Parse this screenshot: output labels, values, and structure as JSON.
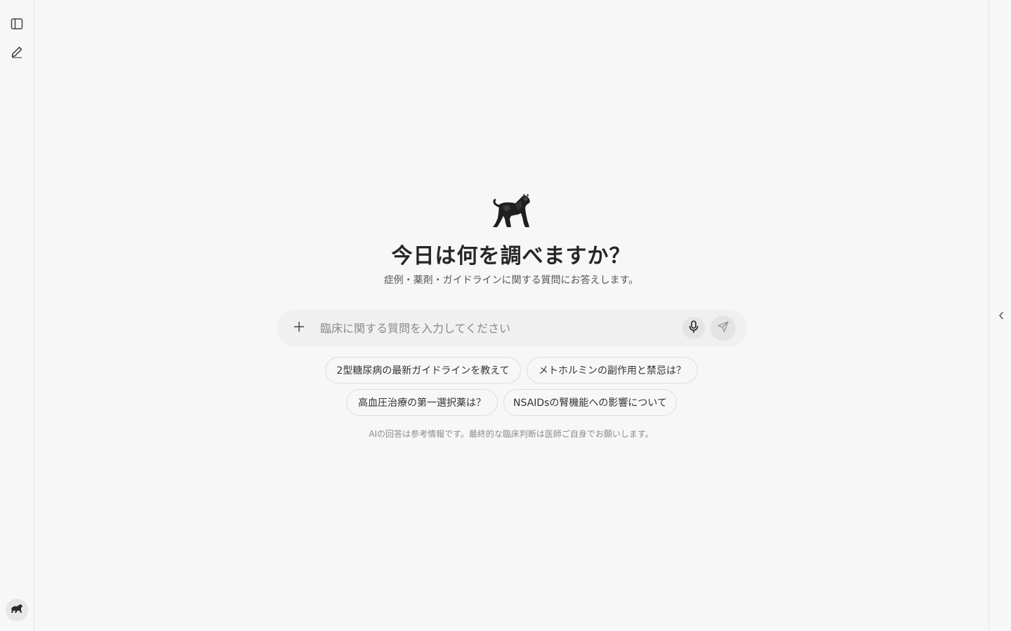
{
  "sidebar": {
    "toggle_icon": "sidebar-panel-icon",
    "new_chat_icon": "pencil-icon",
    "avatar_icon": "panther-avatar-icon"
  },
  "hero": {
    "logo_icon": "panther-logo-icon",
    "title": "今日は何を調べますか？",
    "subtitle": "症例・薬剤・ガイドラインに関する質問にお答えします。"
  },
  "composer": {
    "placeholder": "臨床に関する質問を入力してください",
    "value": "",
    "attach_icon": "plus-icon",
    "mic_icon": "microphone-icon",
    "send_icon": "send-icon"
  },
  "suggestions": [
    {
      "label": "2型糖尿病の最新ガイドラインを教えて"
    },
    {
      "label": "メトホルミンの副作用と禁忌は？"
    },
    {
      "label": "高血圧治療の第一選択薬は？"
    },
    {
      "label": "NSAIDsの腎機能への影響について"
    }
  ],
  "disclaimer": "AIの回答は参考情報です。最終的な臨床判断は医師ご自身でお願いします。",
  "right_panel": {
    "toggle_icon": "chevron-left-icon"
  },
  "colors": {
    "background": "#f7f7f7",
    "composer_bg": "#f0f0f0",
    "chip_border": "#dddddd",
    "text_primary": "#262626",
    "text_muted": "#8c8c8c"
  }
}
